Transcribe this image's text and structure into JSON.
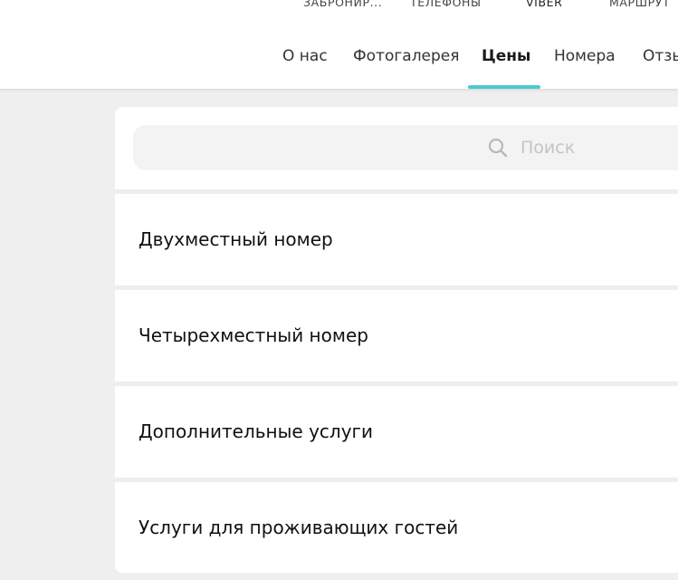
{
  "top_links": {
    "book": "ЗАБРОНИР...",
    "phones": "ТЕЛЕФОНЫ",
    "viber": "VIBER",
    "route": "МАРШРУТ"
  },
  "nav": {
    "items": [
      {
        "label": "О нас"
      },
      {
        "label": "Фотогалерея"
      },
      {
        "label": "Цены",
        "active": true
      },
      {
        "label": "Номера"
      },
      {
        "label": "Отзы"
      }
    ]
  },
  "search": {
    "placeholder": "Поиск",
    "value": ""
  },
  "list": {
    "items": [
      {
        "label": "Двухместный номер"
      },
      {
        "label": "Четырехместный номер"
      },
      {
        "label": "Дополнительные услуги"
      },
      {
        "label": "Услуги для проживающих гостей"
      }
    ]
  },
  "colors": {
    "accent": "#4ec8cf",
    "background": "#efefef",
    "card": "#ffffff"
  }
}
